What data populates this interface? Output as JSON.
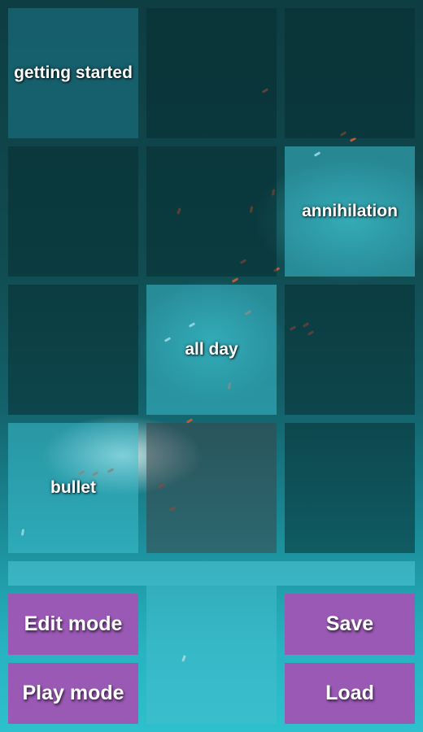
{
  "tiles": {
    "getting_started": "getting started",
    "annihilation": "annihilation",
    "all_day": "all day",
    "bullet": "bullet"
  },
  "buttons": {
    "edit_mode": "Edit mode",
    "play_mode": "Play mode",
    "save": "Save",
    "load": "Load"
  },
  "colors": {
    "button_bg": "#9b59b6",
    "dim_tile": "#0e3c41",
    "lit_tile": "#2bb3c0"
  }
}
